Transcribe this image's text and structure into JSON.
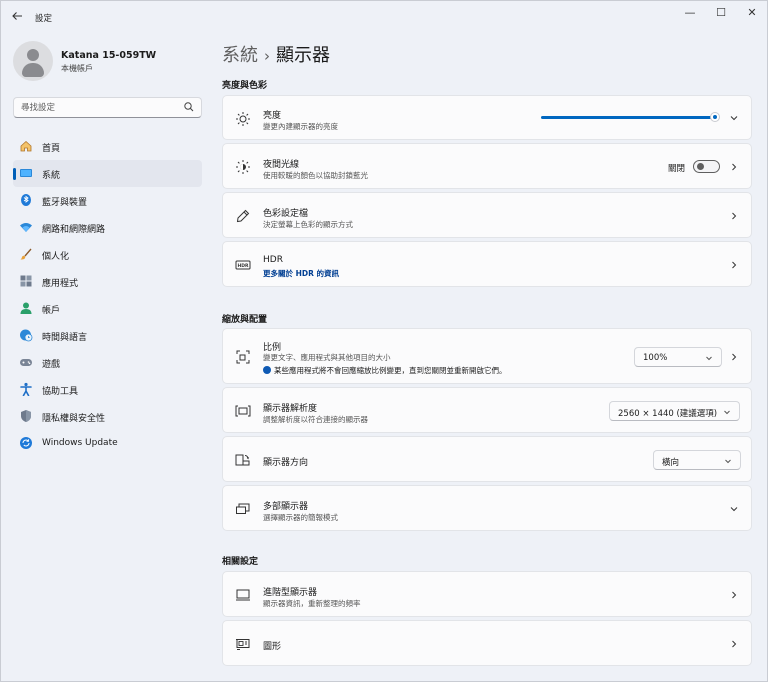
{
  "window": {
    "title": "設定",
    "back_icon": "back-arrow-icon",
    "minimize_glyph": "—",
    "maximize_glyph": "☐",
    "close_glyph": "✕"
  },
  "profile": {
    "name": "Katana 15-059TW",
    "subtitle": "本機帳戶"
  },
  "search": {
    "placeholder": "尋找設定"
  },
  "sidebar": {
    "items": [
      {
        "label": "首頁",
        "icon": "home-icon"
      },
      {
        "label": "系統",
        "icon": "system-icon",
        "active": true
      },
      {
        "label": "藍牙與裝置",
        "icon": "bluetooth-icon"
      },
      {
        "label": "網路和網際網路",
        "icon": "wifi-icon"
      },
      {
        "label": "個人化",
        "icon": "brush-icon"
      },
      {
        "label": "應用程式",
        "icon": "apps-icon"
      },
      {
        "label": "帳戶",
        "icon": "account-icon"
      },
      {
        "label": "時間與語言",
        "icon": "globe-clock-icon"
      },
      {
        "label": "遊戲",
        "icon": "gamepad-icon"
      },
      {
        "label": "協助工具",
        "icon": "accessibility-icon"
      },
      {
        "label": "隱私權與安全性",
        "icon": "shield-icon"
      },
      {
        "label": "Windows Update",
        "icon": "windows-update-icon"
      }
    ]
  },
  "breadcrumb": {
    "parent": "系統",
    "separator": "›",
    "current": "顯示器"
  },
  "sections": {
    "brightness_color": "亮度與色彩",
    "scale_layout": "縮放與配置",
    "related": "相關設定"
  },
  "cards": {
    "brightness": {
      "title": "亮度",
      "desc": "變更內建顯示器的亮度",
      "level_percent": 100
    },
    "night_light": {
      "title": "夜間光線",
      "desc": "使用較暖的顏色以協助封鎖藍光",
      "toggle_label": "關閉",
      "toggle_on": false
    },
    "color_profile": {
      "title": "色彩設定檔",
      "desc": "決定螢幕上色彩的顯示方式"
    },
    "hdr": {
      "title": "HDR",
      "link": "更多關於 HDR 的資訊"
    },
    "scale": {
      "title": "比例",
      "desc": "變更文字、應用程式與其他項目的大小",
      "value": "100%",
      "info": "某些應用程式將不會回應縮放比例變更，直到您關閉並重新開啟它們。"
    },
    "resolution": {
      "title": "顯示器解析度",
      "desc": "調整解析度以符合連接的顯示器",
      "value": "2560 × 1440 (建議選項)"
    },
    "orientation": {
      "title": "顯示器方向",
      "value": "橫向"
    },
    "multiple_displays": {
      "title": "多部顯示器",
      "desc": "選擇顯示器的簡報模式"
    },
    "advanced_display": {
      "title": "進階型顯示器",
      "desc": "顯示器資訊，重新整理的頻率"
    },
    "graphics": {
      "title": "圖形"
    }
  },
  "colors": {
    "accent": "#0067c0",
    "window_bg": "#eef1f7",
    "card_bg": "#fbfbfc"
  }
}
